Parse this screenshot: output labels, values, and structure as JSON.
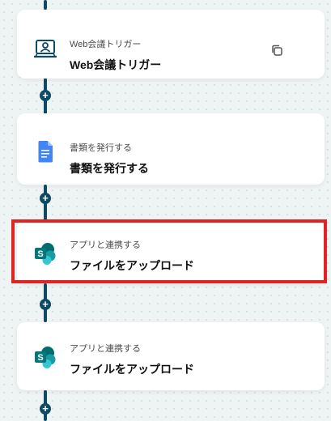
{
  "flow": {
    "steps": [
      {
        "subtitle": "Web会議トリガー",
        "title": "Web会議トリガー",
        "icon": "web-meeting-icon"
      },
      {
        "subtitle": "書類を発行する",
        "title": "書類を発行する",
        "icon": "google-docs-icon"
      },
      {
        "subtitle": "アプリと連携する",
        "title": "ファイルをアップロード",
        "icon": "sharepoint-icon"
      },
      {
        "subtitle": "アプリと連携する",
        "title": "ファイルをアップロード",
        "icon": "sharepoint-icon"
      }
    ],
    "add_symbol": "+",
    "copy_icon": "copy-icon"
  },
  "colors": {
    "connector": "#0f4a63",
    "highlight": "#e02424",
    "docs_blue": "#4285f4",
    "sharepoint_teal": "#037b7b"
  }
}
